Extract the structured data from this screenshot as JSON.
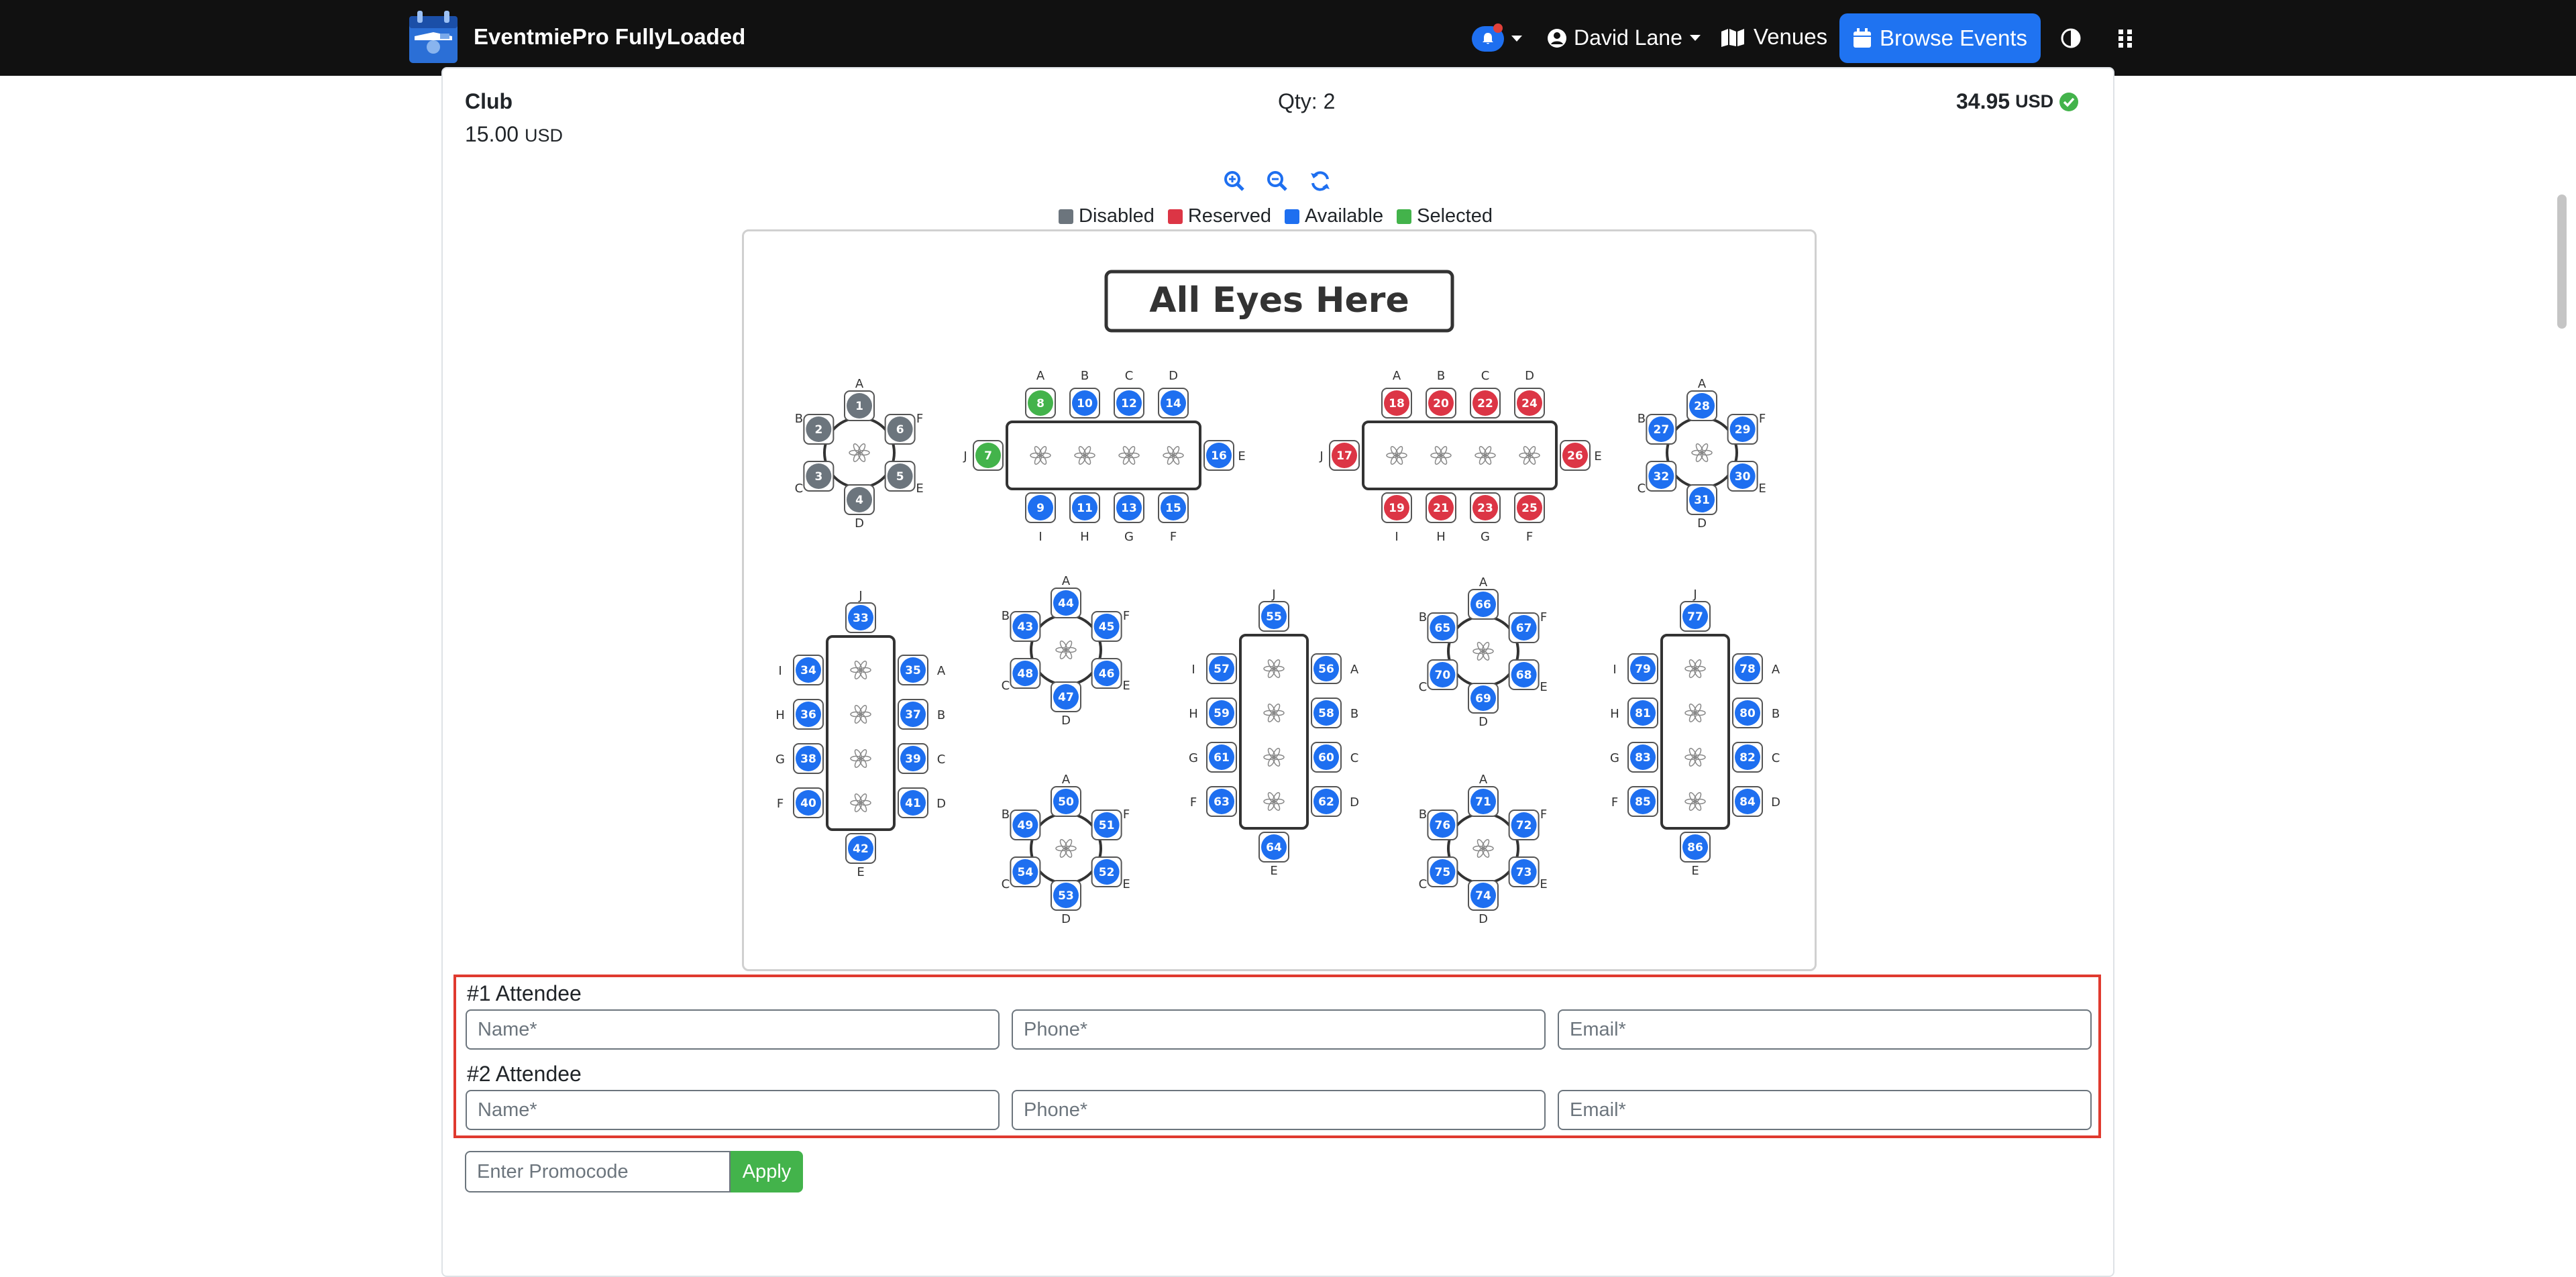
{
  "navbar": {
    "brand": "EventmiePro FullyLoaded",
    "user": "David Lane",
    "venues": "Venues",
    "browse": "Browse Events"
  },
  "ticket": {
    "name": "Club",
    "price": "15.00",
    "currency": "USD",
    "qty": "Qty: 2",
    "total": "34.95"
  },
  "legend": [
    {
      "label": "Disabled",
      "color": "#6c757d"
    },
    {
      "label": "Reserved",
      "color": "#dc3545"
    },
    {
      "label": "Available",
      "color": "#1e6ff0"
    },
    {
      "label": "Selected",
      "color": "#43b34b"
    }
  ],
  "stage": "All Eyes Here",
  "seat_colors": {
    "disabled": "#6c757d",
    "reserved": "#dc3545",
    "available": "#1e6ff0",
    "selected": "#43b34b"
  },
  "tables": [
    {
      "shape": "round",
      "seats": [
        {
          "n": "1",
          "l": "A",
          "s": "disabled"
        },
        {
          "n": "6",
          "l": "F",
          "s": "disabled"
        },
        {
          "n": "5",
          "l": "E",
          "s": "disabled"
        },
        {
          "n": "4",
          "l": "D",
          "s": "disabled"
        },
        {
          "n": "3",
          "l": "C",
          "s": "disabled"
        },
        {
          "n": "2",
          "l": "B",
          "s": "disabled"
        }
      ]
    },
    {
      "shape": "hrect",
      "top": [
        {
          "n": "8",
          "l": "A",
          "s": "selected"
        },
        {
          "n": "10",
          "l": "B",
          "s": "available"
        },
        {
          "n": "12",
          "l": "C",
          "s": "available"
        },
        {
          "n": "14",
          "l": "D",
          "s": "available"
        }
      ],
      "right": {
        "n": "16",
        "l": "E",
        "s": "available"
      },
      "bottom": [
        {
          "n": "9",
          "l": "I",
          "s": "available"
        },
        {
          "n": "11",
          "l": "H",
          "s": "available"
        },
        {
          "n": "13",
          "l": "G",
          "s": "available"
        },
        {
          "n": "15",
          "l": "F",
          "s": "available"
        }
      ],
      "left": {
        "n": "7",
        "l": "J",
        "s": "selected"
      }
    },
    {
      "shape": "hrect",
      "top": [
        {
          "n": "18",
          "l": "A",
          "s": "reserved"
        },
        {
          "n": "20",
          "l": "B",
          "s": "reserved"
        },
        {
          "n": "22",
          "l": "C",
          "s": "reserved"
        },
        {
          "n": "24",
          "l": "D",
          "s": "reserved"
        }
      ],
      "right": {
        "n": "26",
        "l": "E",
        "s": "reserved"
      },
      "bottom": [
        {
          "n": "19",
          "l": "I",
          "s": "reserved"
        },
        {
          "n": "21",
          "l": "H",
          "s": "reserved"
        },
        {
          "n": "23",
          "l": "G",
          "s": "reserved"
        },
        {
          "n": "25",
          "l": "F",
          "s": "reserved"
        }
      ],
      "left": {
        "n": "17",
        "l": "J",
        "s": "reserved"
      }
    },
    {
      "shape": "round",
      "seats": [
        {
          "n": "28",
          "l": "A",
          "s": "available"
        },
        {
          "n": "29",
          "l": "F",
          "s": "available"
        },
        {
          "n": "30",
          "l": "E",
          "s": "available"
        },
        {
          "n": "31",
          "l": "D",
          "s": "available"
        },
        {
          "n": "32",
          "l": "C",
          "s": "available"
        },
        {
          "n": "27",
          "l": "B",
          "s": "available"
        }
      ]
    },
    {
      "shape": "vrect",
      "top": {
        "n": "33",
        "l": "J",
        "s": "available"
      },
      "left": [
        {
          "n": "34",
          "l": "I",
          "s": "available"
        },
        {
          "n": "36",
          "l": "H",
          "s": "available"
        },
        {
          "n": "38",
          "l": "G",
          "s": "available"
        },
        {
          "n": "40",
          "l": "F",
          "s": "available"
        }
      ],
      "right": [
        {
          "n": "35",
          "l": "A",
          "s": "available"
        },
        {
          "n": "37",
          "l": "B",
          "s": "available"
        },
        {
          "n": "39",
          "l": "C",
          "s": "available"
        },
        {
          "n": "41",
          "l": "D",
          "s": "available"
        }
      ],
      "bottom": {
        "n": "42",
        "l": "E",
        "s": "available"
      }
    },
    {
      "shape": "round",
      "seats": [
        {
          "n": "44",
          "l": "A",
          "s": "available"
        },
        {
          "n": "45",
          "l": "F",
          "s": "available"
        },
        {
          "n": "46",
          "l": "E",
          "s": "available"
        },
        {
          "n": "47",
          "l": "D",
          "s": "available"
        },
        {
          "n": "48",
          "l": "C",
          "s": "available"
        },
        {
          "n": "43",
          "l": "B",
          "s": "available"
        }
      ]
    },
    {
      "shape": "round",
      "seats": [
        {
          "n": "50",
          "l": "A",
          "s": "available"
        },
        {
          "n": "51",
          "l": "F",
          "s": "available"
        },
        {
          "n": "52",
          "l": "E",
          "s": "available"
        },
        {
          "n": "53",
          "l": "D",
          "s": "available"
        },
        {
          "n": "54",
          "l": "C",
          "s": "available"
        },
        {
          "n": "49",
          "l": "B",
          "s": "available"
        }
      ]
    },
    {
      "shape": "vrect",
      "top": {
        "n": "55",
        "l": "J",
        "s": "available"
      },
      "left": [
        {
          "n": "57",
          "l": "I",
          "s": "available"
        },
        {
          "n": "59",
          "l": "H",
          "s": "available"
        },
        {
          "n": "61",
          "l": "G",
          "s": "available"
        },
        {
          "n": "63",
          "l": "F",
          "s": "available"
        }
      ],
      "right": [
        {
          "n": "56",
          "l": "A",
          "s": "available"
        },
        {
          "n": "58",
          "l": "B",
          "s": "available"
        },
        {
          "n": "60",
          "l": "C",
          "s": "available"
        },
        {
          "n": "62",
          "l": "D",
          "s": "available"
        }
      ],
      "bottom": {
        "n": "64",
        "l": "E",
        "s": "available"
      }
    },
    {
      "shape": "round",
      "seats": [
        {
          "n": "66",
          "l": "A",
          "s": "available"
        },
        {
          "n": "67",
          "l": "F",
          "s": "available"
        },
        {
          "n": "68",
          "l": "E",
          "s": "available"
        },
        {
          "n": "69",
          "l": "D",
          "s": "available"
        },
        {
          "n": "70",
          "l": "C",
          "s": "available"
        },
        {
          "n": "65",
          "l": "B",
          "s": "available"
        }
      ]
    },
    {
      "shape": "round",
      "seats": [
        {
          "n": "71",
          "l": "A",
          "s": "available"
        },
        {
          "n": "72",
          "l": "F",
          "s": "available"
        },
        {
          "n": "73",
          "l": "E",
          "s": "available"
        },
        {
          "n": "74",
          "l": "D",
          "s": "available"
        },
        {
          "n": "75",
          "l": "C",
          "s": "available"
        },
        {
          "n": "76",
          "l": "B",
          "s": "available"
        }
      ]
    },
    {
      "shape": "vrect",
      "top": {
        "n": "77",
        "l": "J",
        "s": "available"
      },
      "left": [
        {
          "n": "79",
          "l": "I",
          "s": "available"
        },
        {
          "n": "81",
          "l": "H",
          "s": "available"
        },
        {
          "n": "83",
          "l": "G",
          "s": "available"
        },
        {
          "n": "85",
          "l": "F",
          "s": "available"
        }
      ],
      "right": [
        {
          "n": "78",
          "l": "A",
          "s": "available"
        },
        {
          "n": "80",
          "l": "B",
          "s": "available"
        },
        {
          "n": "82",
          "l": "C",
          "s": "available"
        },
        {
          "n": "84",
          "l": "D",
          "s": "available"
        }
      ],
      "bottom": {
        "n": "86",
        "l": "E",
        "s": "available"
      }
    }
  ],
  "attendees": [
    {
      "title": "#1 Attendee",
      "name": "Name*",
      "phone": "Phone*",
      "email": "Email*"
    },
    {
      "title": "#2 Attendee",
      "name": "Name*",
      "phone": "Phone*",
      "email": "Email*"
    }
  ],
  "promo": {
    "placeholder": "Enter Promocode",
    "apply": "Apply"
  }
}
